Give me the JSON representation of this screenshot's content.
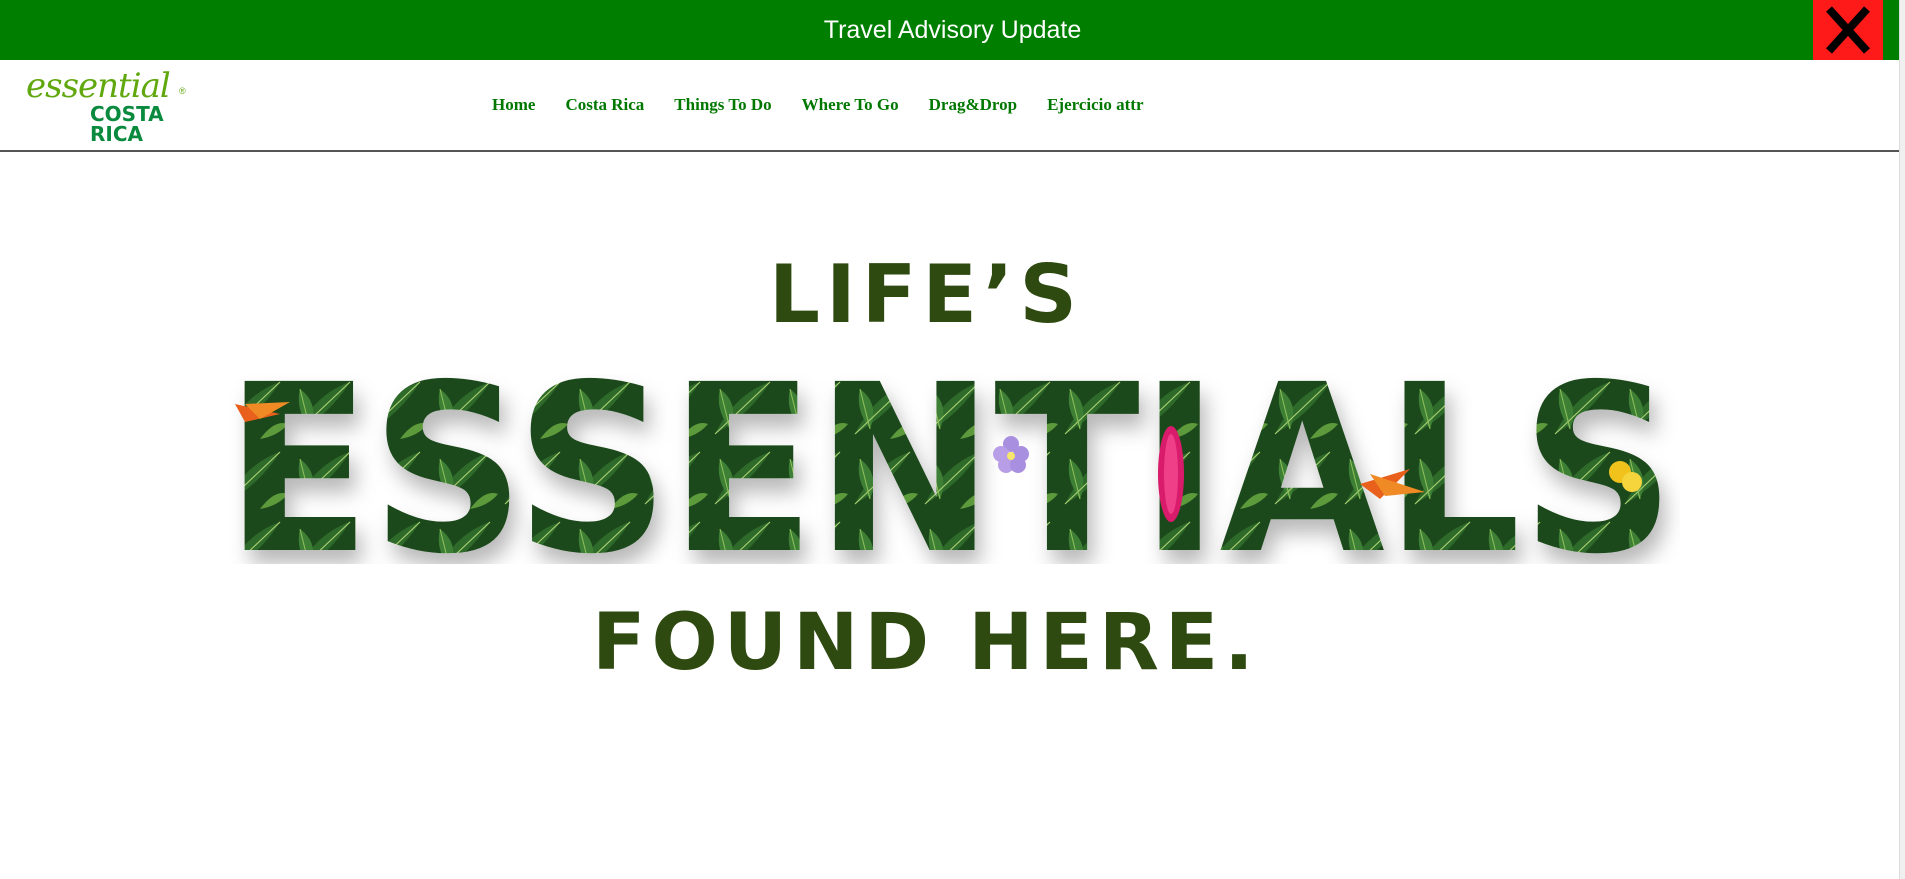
{
  "advisory": {
    "text": "Travel Advisory Update"
  },
  "logo": {
    "script": "essential",
    "line1": "COSTA",
    "line2": "RICA",
    "registered": "®"
  },
  "nav": [
    {
      "label": "Home"
    },
    {
      "label": "Costa Rica"
    },
    {
      "label": "Things To Do"
    },
    {
      "label": "Where To Go"
    },
    {
      "label": "Drag&Drop"
    },
    {
      "label": "Ejercicio attr"
    }
  ],
  "hero": {
    "top_text": "LIFE’S",
    "main_text": "ESSENTIALS",
    "bottom_text": "FOUND HERE."
  },
  "colors": {
    "banner": "#007e00",
    "close": "#ff1a1a",
    "nav_link": "#007800",
    "hero_text": "#2e4a10",
    "leaf_dark": "#1f4a1c",
    "leaf_mid": "#2e6b2a",
    "leaf_light": "#5c9a3a"
  },
  "icons": {
    "close": "close-x-icon"
  }
}
